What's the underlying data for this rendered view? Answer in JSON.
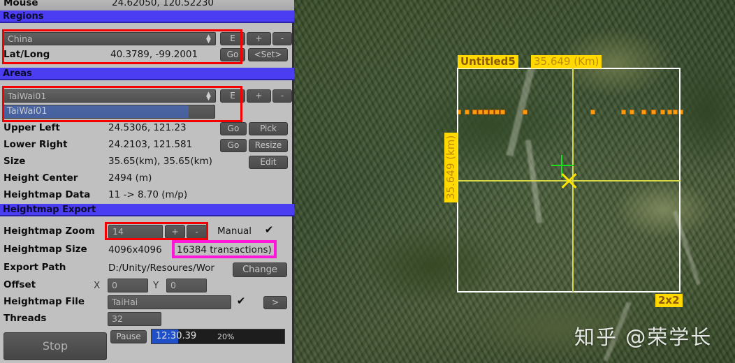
{
  "panel": {
    "mouse": {
      "label": "Mouse",
      "value": "24.62050, 120.52230"
    },
    "sections": {
      "regions": "Regions",
      "areas": "Areas",
      "heightmap_export": "Heightmap Export"
    },
    "regions": {
      "dropdown_value": "China",
      "edit_button": "E",
      "add_button": "+",
      "remove_button": "-",
      "latlong_label": "Lat/Long",
      "latlong_value": "40.3789, -99.2001",
      "go_button": "Go",
      "set_button": "<Set>"
    },
    "areas": {
      "dropdown_value": "TaiWai01",
      "edit_button": "E",
      "add_button": "+",
      "remove_button": "-",
      "name_input": "TaiWai01",
      "upper_left_label": "Upper Left",
      "upper_left_value": "24.5306, 121.23",
      "upper_left_go": "Go",
      "upper_left_pick": "Pick",
      "lower_right_label": "Lower Right",
      "lower_right_value": "24.2103, 121.581",
      "lower_right_go": "Go",
      "lower_right_resize": "Resize",
      "size_label": "Size",
      "size_value": "35.65(km), 35.65(km)",
      "size_edit": "Edit",
      "height_center_label": "Height Center",
      "height_center_value": "2494 (m)",
      "heightmap_data_label": "Heightmap Data",
      "heightmap_data_value": "11 -> 8.70 (m/p)"
    },
    "export": {
      "zoom_label": "Heightmap Zoom",
      "zoom_value": "14",
      "zoom_plus": "+",
      "zoom_minus": "-",
      "manual_label": "Manual",
      "manual_checked": "✔",
      "size_label": "Heightmap Size",
      "size_value": "4096x4096",
      "transactions_value": "16384 transactions)",
      "path_label": "Export Path",
      "path_value": "D:/Unity/Resoures/Wor",
      "change_button": "Change",
      "offset_label": "Offset",
      "offset_x_label": "X",
      "offset_x_value": "0",
      "offset_y_label": "Y",
      "offset_y_value": "0",
      "file_label": "Heightmap File",
      "file_value": "TaiHai",
      "file_checked": "✔",
      "file_browse": ">",
      "threads_label": "Threads",
      "threads_value": "32"
    },
    "footer": {
      "stop_button": "Stop",
      "pause_button": "Pause",
      "progress_time": "12:30.39",
      "progress_percent": "20%",
      "progress_fraction": 20
    }
  },
  "map": {
    "area_name": "Untitled5",
    "width_label": "35.649 (Km)",
    "height_label": "35.649 (km)",
    "tile_label": "2x2",
    "watermark": "知乎 @荣学长"
  },
  "colors": {
    "section_header_blue": "#4b3df2",
    "panel_gray": "#c0c0c0",
    "annotation_red": "#f50000",
    "annotation_magenta": "#ff16d8",
    "label_yellow": "#ffd900",
    "crosshair_green": "#19e019",
    "guide_yellow": "#d8d84a"
  }
}
